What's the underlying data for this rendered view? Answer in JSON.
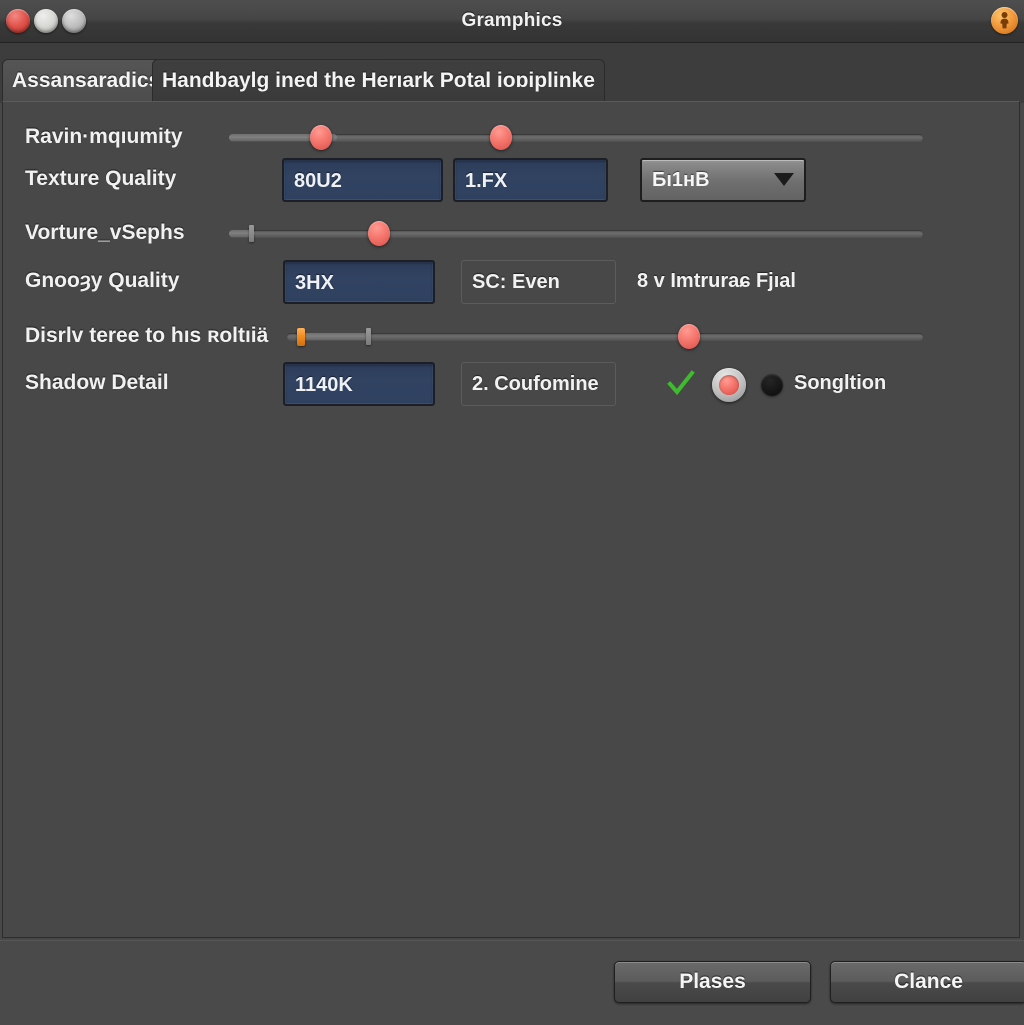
{
  "window": {
    "title": "Gramphics",
    "traffic_lights": [
      {
        "name": "close",
        "color": "#e2554d"
      },
      {
        "name": "minimize",
        "color": "#d6d6d2"
      },
      {
        "name": "maximize",
        "color": "#bdbdbd"
      }
    ],
    "corner_badge_icon": "orange-person-icon"
  },
  "tabs": [
    {
      "label": "Assansaradics",
      "active": true
    },
    {
      "label": "Handbaylg ined the Herıark Potal ioɒiplinke",
      "active": false
    }
  ],
  "rows": [
    {
      "label": "Ravin·mqıumity",
      "control": "slider",
      "handles": [
        "318",
        "498"
      ]
    },
    {
      "label": "Texture Quality",
      "field_1": "80U2",
      "field_2": "1.FX",
      "dropdown_value": "Бı1нB"
    },
    {
      "label": "Vorture_vSephs",
      "control": "slider",
      "handles": [
        "376"
      ]
    },
    {
      "label": "Gnooȝy Quality",
      "field_1": "3HX",
      "field_2": "SC: Even",
      "note": "8 v Imtruraɕ Fjıal"
    },
    {
      "label": "Disrlv teree to hıs ʀoltıiä",
      "control": "slider",
      "handles": [
        "298",
        "686"
      ]
    },
    {
      "label": "Shadow Detail",
      "field_1": "1140K",
      "field_2": "2. Coufomine",
      "radio_label": "Songltion"
    }
  ],
  "footer": {
    "ok_label": "Plases",
    "cancel_label": "Clance"
  },
  "colors": {
    "window_bg": "#484848",
    "titlebar": "#3f3f3f",
    "field_blue": "#2f4160",
    "knob_red": "#f4766c",
    "knob_orange": "#f08a1e",
    "check_green": "#3fbb2e",
    "accent_orange": "#f0973a"
  }
}
